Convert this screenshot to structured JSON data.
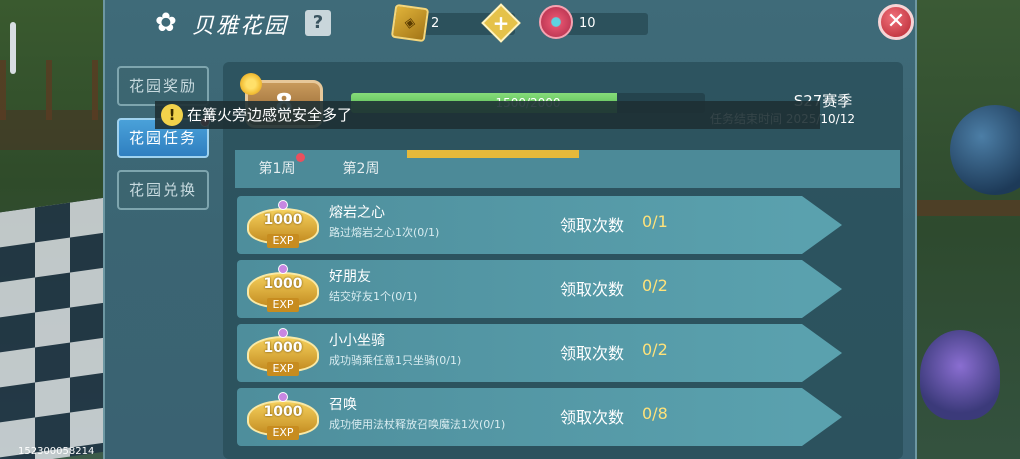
{
  "header": {
    "title": "贝雅花园",
    "help": "?",
    "close": "✕",
    "resources": [
      {
        "icon": "gold-ticket-icon",
        "value": "2"
      },
      {
        "icon": "flower-gem-icon",
        "value": "10"
      }
    ],
    "add_label": "+"
  },
  "side_tabs": [
    {
      "label": "花园奖励",
      "active": false,
      "notify": false
    },
    {
      "label": "花园任务",
      "active": true,
      "notify": true
    },
    {
      "label": "花园兑换",
      "active": false,
      "notify": false
    }
  ],
  "level": {
    "value": "8"
  },
  "progress": {
    "text": "1500/2000",
    "current": 1500,
    "max": 2000
  },
  "season": {
    "name": "S27赛季",
    "deadline": "任务结束时间 2025/10/12"
  },
  "weeks": [
    {
      "label": "第1周",
      "notify": true
    },
    {
      "label": "第2周",
      "notify": false
    },
    {
      "label": "",
      "active": true
    }
  ],
  "toast": {
    "text": "在篝火旁边感觉安全多了",
    "icon": "!"
  },
  "tasks": [
    {
      "exp": "1000",
      "exp_tag": "EXP",
      "name": "熔岩之心",
      "desc": "路过熔岩之心1次(0/1)",
      "claim_label": "领取次数",
      "claim_count": "0/1"
    },
    {
      "exp": "1000",
      "exp_tag": "EXP",
      "name": "好朋友",
      "desc": "结交好友1个(0/1)",
      "claim_label": "领取次数",
      "claim_count": "0/2"
    },
    {
      "exp": "1000",
      "exp_tag": "EXP",
      "name": "小小坐骑",
      "desc": "成功骑乘任意1只坐骑(0/1)",
      "claim_label": "领取次数",
      "claim_count": "0/2"
    },
    {
      "exp": "1000",
      "exp_tag": "EXP",
      "name": "召唤",
      "desc": "成功使用法杖释放召唤魔法1次(0/1)",
      "claim_label": "领取次数",
      "claim_count": "0/8"
    }
  ],
  "footer": {
    "id": "152300058214"
  }
}
